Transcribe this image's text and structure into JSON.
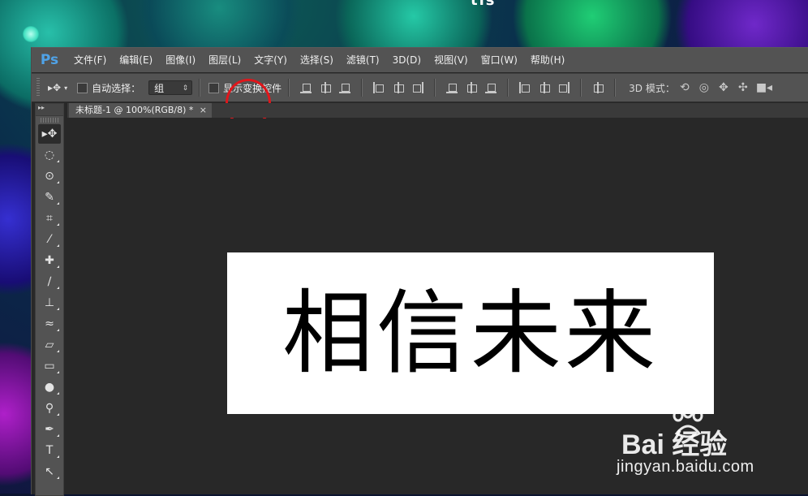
{
  "app": {
    "logo": "Ps",
    "accent": "#4fa3e8",
    "annotation_color": "#e0161b"
  },
  "desktop": {
    "partial_text": "tis"
  },
  "menu": {
    "items": [
      {
        "label": "文件(F)"
      },
      {
        "label": "编辑(E)"
      },
      {
        "label": "图像(I)"
      },
      {
        "label": "图层(L)",
        "highlighted": true
      },
      {
        "label": "文字(Y)"
      },
      {
        "label": "选择(S)"
      },
      {
        "label": "滤镜(T)"
      },
      {
        "label": "3D(D)"
      },
      {
        "label": "视图(V)"
      },
      {
        "label": "窗口(W)"
      },
      {
        "label": "帮助(H)"
      }
    ]
  },
  "options": {
    "auto_select_label": "自动选择：",
    "auto_select_checked": false,
    "auto_select_value": "组",
    "show_transform_label": "显示变换控件",
    "show_transform_checked": false,
    "mode_3d_label": "3D 模式："
  },
  "document": {
    "tab_title": "未标题-1 @ 100%(RGB/8) *",
    "close_glyph": "×",
    "text": "相信未来"
  },
  "watermark": {
    "brand": "Bai  经验",
    "url": "jingyan.baidu.com"
  }
}
